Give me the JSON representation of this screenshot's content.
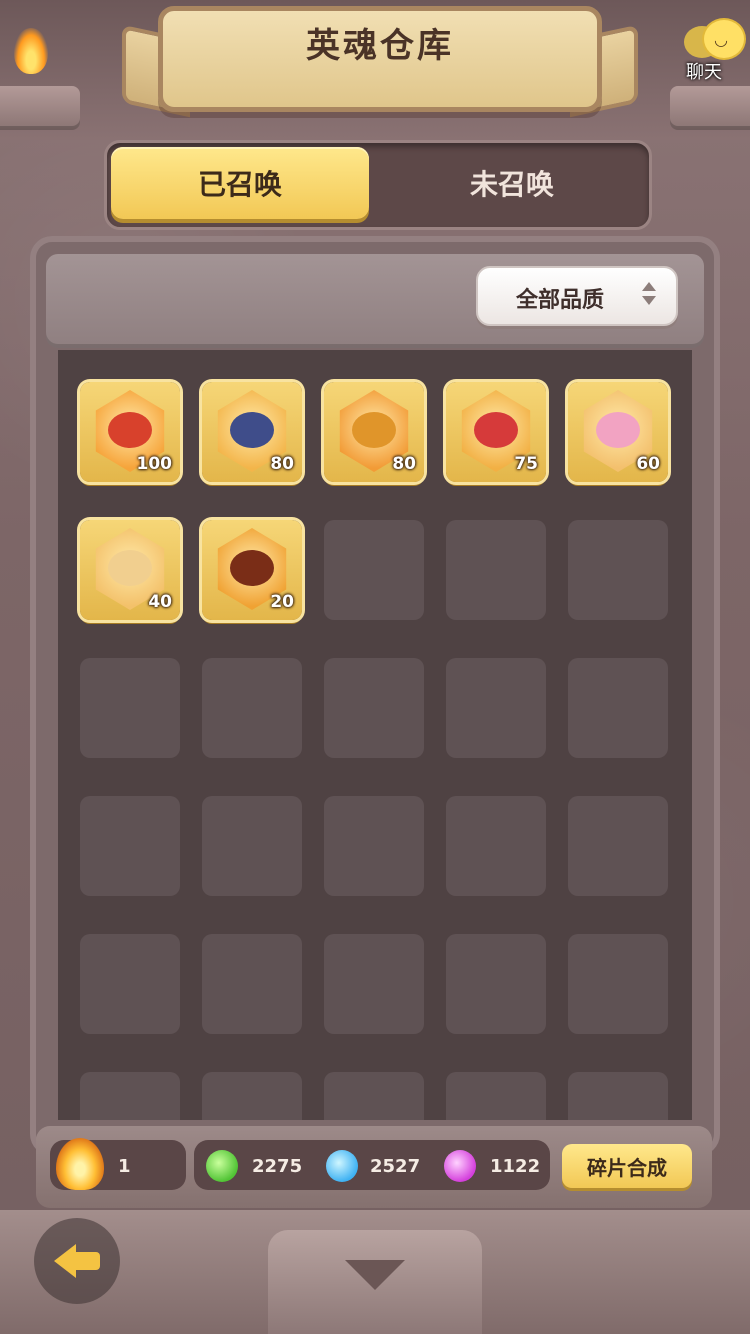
{
  "header": {
    "title": "英魂仓库",
    "chat_label": "聊天"
  },
  "tabs": [
    {
      "label": "已召唤",
      "active": true
    },
    {
      "label": "未召唤",
      "active": false
    }
  ],
  "filter": {
    "label": "全部品质"
  },
  "heroes": [
    {
      "level": "100",
      "gem_color": "#f6a43a",
      "face_color": "#d8412c"
    },
    {
      "level": "80",
      "gem_color": "#f3b54a",
      "face_color": "#3f4d8a"
    },
    {
      "level": "80",
      "gem_color": "#f29b36",
      "face_color": "#e0952a"
    },
    {
      "level": "75",
      "gem_color": "#f2b044",
      "face_color": "#d63a3a"
    },
    {
      "level": "60",
      "gem_color": "#f3c06d",
      "face_color": "#f2a3c2"
    },
    {
      "level": "40",
      "gem_color": "#f3c16a",
      "face_color": "#f1cf8f"
    },
    {
      "level": "20",
      "gem_color": "#f0a233",
      "face_color": "#7a2d17"
    }
  ],
  "resources": {
    "fire": "1",
    "green": "2275",
    "blue": "2527",
    "purple": "1122"
  },
  "synthesize_label": "碎片合成"
}
